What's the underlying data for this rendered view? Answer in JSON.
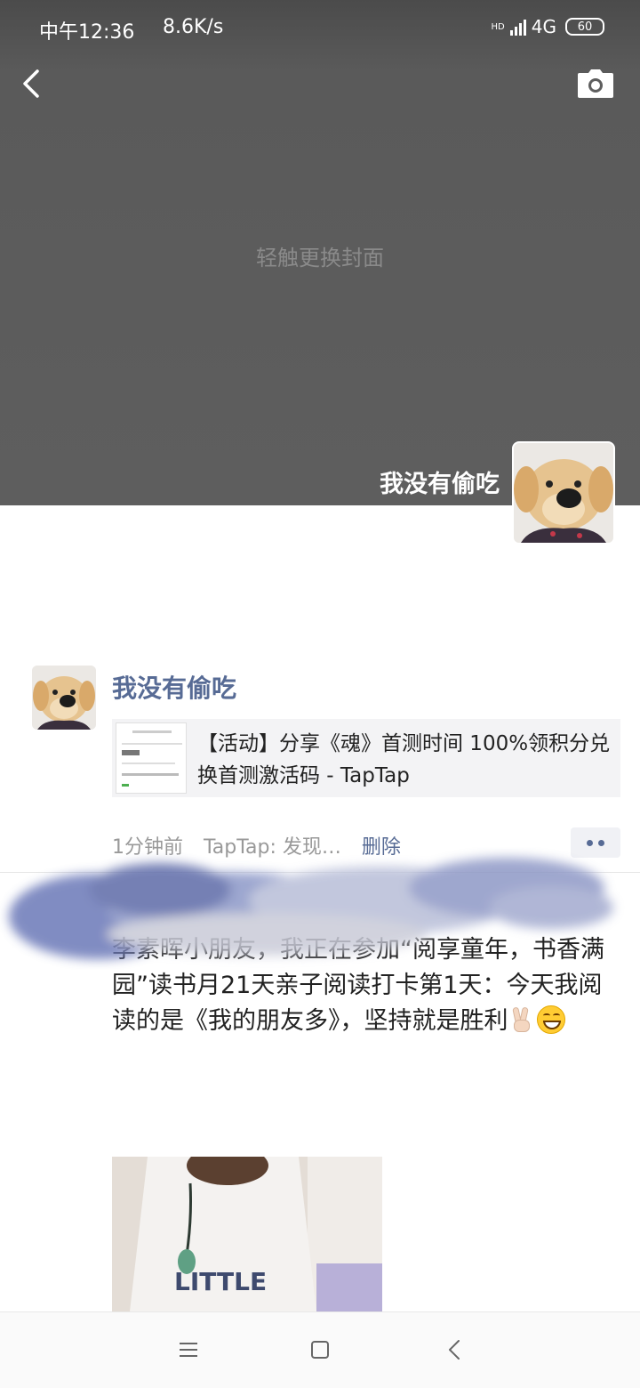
{
  "status_bar": {
    "time": "中午12:36",
    "speed": "8.6K/s",
    "network_badge": "HD",
    "network": "4G",
    "battery": "60"
  },
  "cover": {
    "hint": "轻触更换封面"
  },
  "profile": {
    "name": "我没有偷吃"
  },
  "posts": [
    {
      "author": "我没有偷吃",
      "share": {
        "title": "【活动】分享《魂》首测时间 100%领积分兑换首测激活码 - TapTap"
      },
      "time": "1分钟前",
      "source": "TapTap: 发现…",
      "delete_label": "删除"
    },
    {
      "text": "李素晖小朋友，我正在参加“阅享童年，书香满园”读书月21天亲子阅读打卡第1天：今天我阅读的是《我的朋友多》，坚持就是胜利"
    }
  ],
  "icons": {
    "back": "back-arrow-icon",
    "camera": "camera-icon",
    "more": "more-dots-icon",
    "nav_menu": "menu-icon",
    "nav_home": "home-icon",
    "nav_back": "back-icon"
  },
  "colors": {
    "link": "#576b95",
    "cover": "#5e5e5e"
  }
}
